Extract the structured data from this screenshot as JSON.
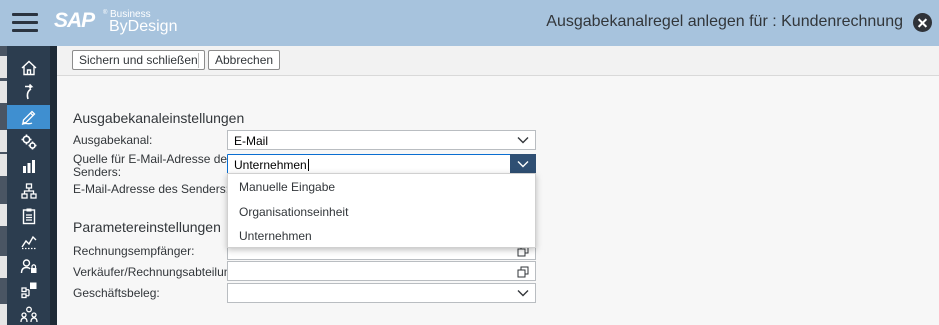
{
  "header": {
    "logo_sap": "SAP",
    "logo_reg": "®",
    "logo_business": "Business",
    "logo_bydesign": "ByDesign",
    "page_title": "Ausgabekanalregel anlegen für : Kundenrechnung",
    "bg_color": "#a7c3dd"
  },
  "leftnav": {
    "items": [
      {
        "icon": "home-icon"
      },
      {
        "icon": "refresh-icon"
      },
      {
        "icon": "edit-icon",
        "active": true
      },
      {
        "icon": "settings-icon"
      },
      {
        "icon": "bar-chart-icon"
      },
      {
        "icon": "hierarchy-icon"
      },
      {
        "icon": "clipboard-icon"
      },
      {
        "icon": "line-chart-icon"
      },
      {
        "icon": "user-lock-icon"
      },
      {
        "icon": "org-chart-icon"
      },
      {
        "icon": "people-icon"
      }
    ],
    "active_color": "#3f8fd0"
  },
  "toolbar": {
    "save_close_label": "Sichern und schließen",
    "cancel_label": "Abbrechen"
  },
  "form": {
    "section1_title": "Ausgabekanaleinstellungen",
    "channel_label": "Ausgabekanal:",
    "channel_value": "E-Mail",
    "source_label_line1": "Quelle für E-Mail-Adresse des",
    "source_label_line2": "Senders:",
    "source_value": "Unternehmen",
    "sender_label": "E-Mail-Adresse des Senders:",
    "section2_title": "Parametereinstellungen",
    "recipient_label": "Rechnungsempfänger:",
    "recipient_value": "",
    "seller_label": "Verkäufer/Rechnungsabteilung:",
    "seller_value": "",
    "document_label": "Geschäftsbeleg:",
    "document_value": ""
  },
  "dropdown": {
    "options": [
      "Manuelle Eingabe",
      "Organisationseinheit",
      "Unternehmen"
    ]
  }
}
